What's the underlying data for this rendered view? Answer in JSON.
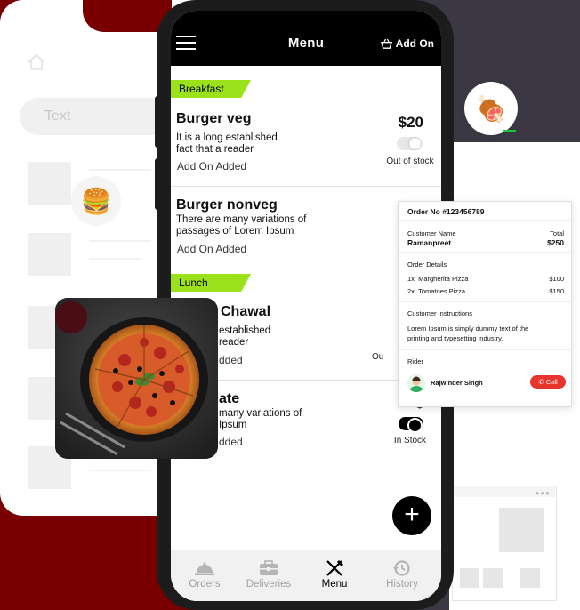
{
  "background": {
    "search_placeholder": "Text",
    "burger_icon": "burger-emoji",
    "meat_icon": "meat-emoji"
  },
  "header": {
    "title": "Menu",
    "add_on_label": "Add On"
  },
  "categories": [
    {
      "label": "Breakfast"
    },
    {
      "label": "Lunch"
    }
  ],
  "items": [
    {
      "name": "Burger veg",
      "desc_line1": "It is a long established",
      "desc_line2": "fact that a reader",
      "addon": "Add On Added",
      "price": "$20",
      "stock": "Out of stock",
      "available": false
    },
    {
      "name": "Burger nonveg",
      "desc_line1": "There are many variations of",
      "desc_line2": "passages of Lorem Ipsum",
      "addon": "Add On Added",
      "price": "",
      "stock": "",
      "available": false
    },
    {
      "name": "Chawal",
      "desc_line1": "established",
      "desc_line2": "reader",
      "addon": "dded",
      "price": "",
      "stock": "Ou",
      "available": false
    },
    {
      "name": "ate",
      "desc_line1": "many variations of",
      "desc_line2": "Ipsum",
      "addon": "dded",
      "price": "$",
      "stock": "In Stock",
      "available": true
    }
  ],
  "bottom_nav": [
    {
      "label": "Orders",
      "icon": "cloche-icon",
      "active": false
    },
    {
      "label": "Deliveries",
      "icon": "toolbox-icon",
      "active": false
    },
    {
      "label": "Menu",
      "icon": "fork-knife-icon",
      "active": true
    },
    {
      "label": "History",
      "icon": "history-icon",
      "active": false
    }
  ],
  "order": {
    "order_no": "Order No #123456789",
    "customer_name_label": "Customer Name",
    "customer_name": "Ramanpreet",
    "total_label": "Total",
    "total": "$250",
    "details_label": "Order Details",
    "lines": [
      {
        "qty": "1x",
        "name": "Margherita Pizza",
        "price": "$100"
      },
      {
        "qty": "2x",
        "name": "Tomatoes Pizza",
        "price": "$150"
      }
    ],
    "instructions_label": "Customer Instructions",
    "instructions_line1": "Lorem Ipsum is simply dummy text of the",
    "instructions_line2": "printing and typesetting industry.",
    "rider_label": "Rider",
    "rider_name": "Rajwinder Singh",
    "call_label": "Call"
  },
  "colors": {
    "accent_green": "#9be21a",
    "call_red": "#e8352b",
    "dark_red": "#7a0000",
    "slate": "#3b3843"
  }
}
